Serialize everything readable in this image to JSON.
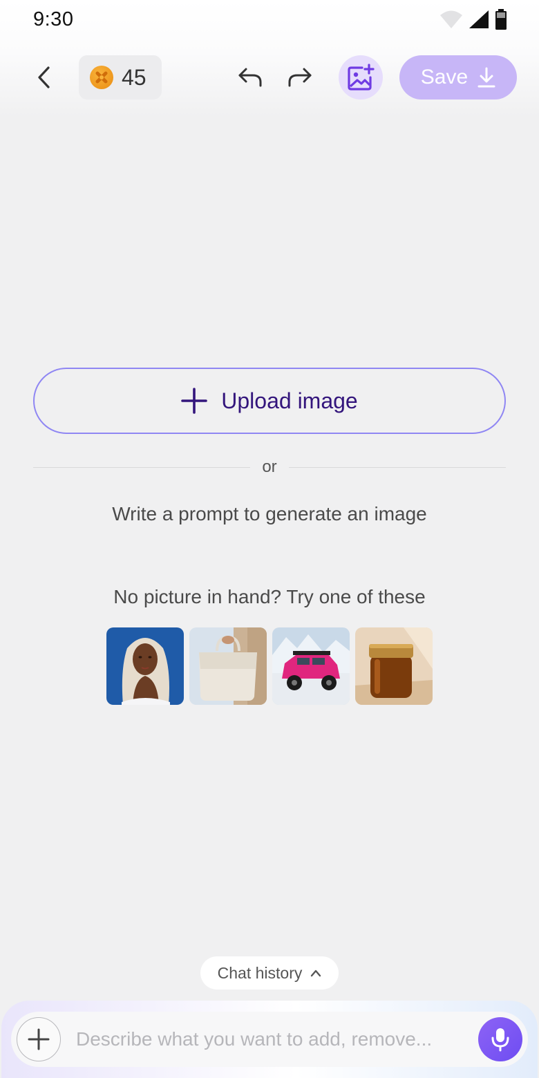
{
  "status_bar": {
    "time": "9:30",
    "icons": [
      "wifi-icon",
      "signal-icon",
      "battery-icon"
    ]
  },
  "toolbar": {
    "back_icon": "chevron-left-icon",
    "credits": {
      "icon": "coin-icon",
      "count": "45"
    },
    "undo_icon": "undo-icon",
    "redo_icon": "redo-icon",
    "add_image_icon": "image-add-icon",
    "save_label": "Save",
    "save_icon": "download-icon"
  },
  "main": {
    "upload_label": "Upload image",
    "divider_text": "or",
    "prompt_hint": "Write a prompt to generate an image",
    "try_text": "No picture in hand? Try one of these",
    "samples": [
      "portrait",
      "handbag",
      "pink-jeep",
      "amber-jar"
    ]
  },
  "chat_history": {
    "label": "Chat history",
    "icon": "chevron-up-icon"
  },
  "composer": {
    "placeholder": "Describe what you want to add, remove...",
    "plus_icon": "plus-icon",
    "mic_icon": "microphone-icon"
  },
  "colors": {
    "accent": "#6e4df2",
    "save_bg": "#c7b6f7",
    "upload_border": "#8f86f3",
    "upload_text": "#33157c",
    "background": "#f0f0f1"
  }
}
